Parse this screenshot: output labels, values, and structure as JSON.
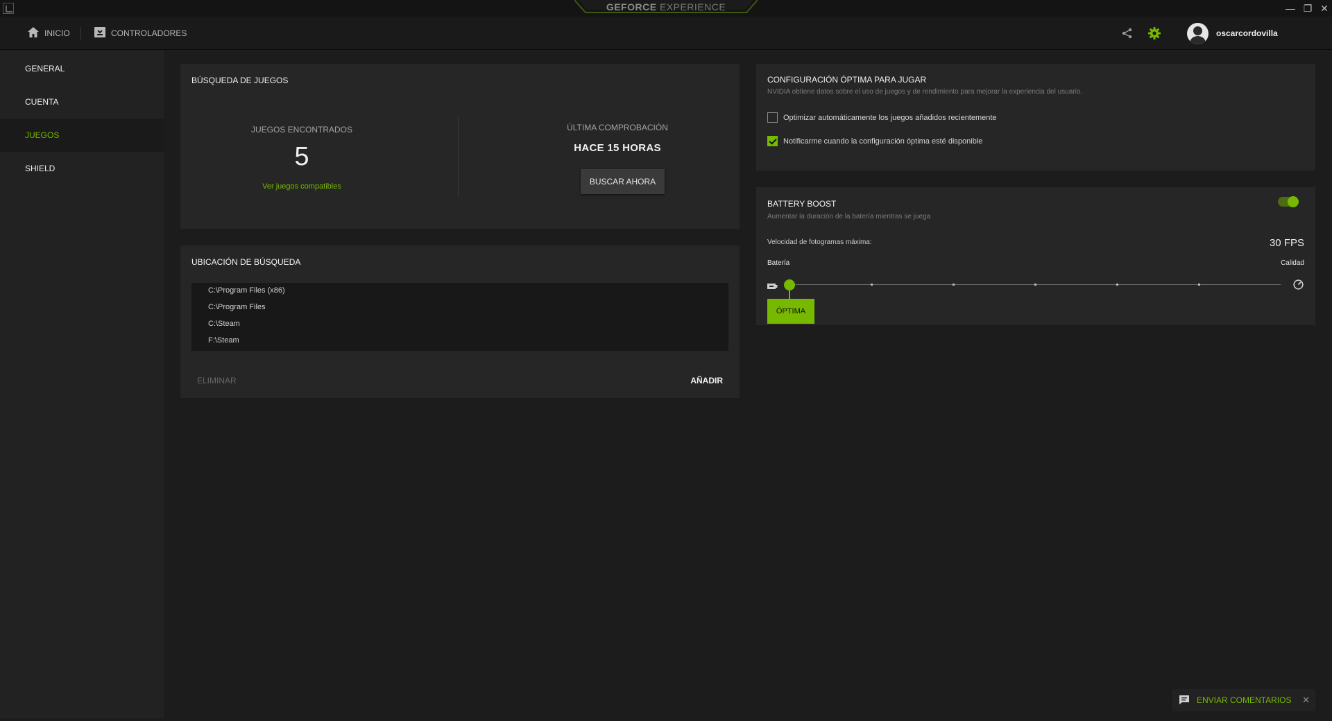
{
  "window": {
    "brand_bold": "GEFORCE",
    "brand_light": "EXPERIENCE",
    "controls": {
      "minimize": "—",
      "restore": "❐",
      "close": "✕"
    }
  },
  "topnav": {
    "items": [
      {
        "label": "INICIO",
        "icon": "home-icon"
      },
      {
        "label": "CONTROLADORES",
        "icon": "drivers-icon"
      }
    ],
    "share_icon": "share-icon",
    "settings_icon": "gear-icon",
    "username": "oscarcordovilla"
  },
  "sidebar": {
    "items": [
      {
        "label": "GENERAL",
        "active": false
      },
      {
        "label": "CUENTA",
        "active": false
      },
      {
        "label": "JUEGOS",
        "active": true
      },
      {
        "label": "SHIELD",
        "active": false
      }
    ]
  },
  "game_search": {
    "title": "BÚSQUEDA DE JUEGOS",
    "found_label": "JUEGOS ENCONTRADOS",
    "found_count": "5",
    "compatible_link": "Ver juegos compatibles",
    "last_check_label": "ÚLTIMA COMPROBACIÓN",
    "last_check_value": "HACE 15 HORAS",
    "scan_button": "BUSCAR AHORA"
  },
  "search_location": {
    "title": "UBICACIÓN DE BÚSQUEDA",
    "paths": [
      "C:\\Program Files (x86)",
      "C:\\Program Files",
      "C:\\Steam",
      "F:\\Steam"
    ],
    "remove_button": "ELIMINAR",
    "add_button": "AÑADIR"
  },
  "optimal_settings": {
    "title": "CONFIGURACIÓN ÓPTIMA PARA JUGAR",
    "description": "NVIDIA obtiene datos sobre el uso de juegos y de rendimiento para mejorar la experiencia del usuario.",
    "options": [
      {
        "label": "Optimizar automáticamente los juegos añadidos recientemente",
        "checked": false
      },
      {
        "label": "Notificarme cuando la configuración óptima esté disponible",
        "checked": true
      }
    ]
  },
  "battery_boost": {
    "title": "BATTERY BOOST",
    "description": "Aumentar la duración de la batería mientras se juega",
    "enabled": true,
    "fps_label": "Velocidad de fotogramas máxima:",
    "fps_value": "30 FPS",
    "left_label": "Batería",
    "right_label": "Calidad",
    "slider_position": 0,
    "optimal_button": "ÓPTIMA"
  },
  "feedback": {
    "label": "ENVIAR COMENTARIOS",
    "icon": "comment-icon",
    "close_icon": "close-icon"
  },
  "colors": {
    "accent": "#76b900",
    "background": "#1c1c1c",
    "panel": "#262626",
    "sidebar": "#222222"
  }
}
